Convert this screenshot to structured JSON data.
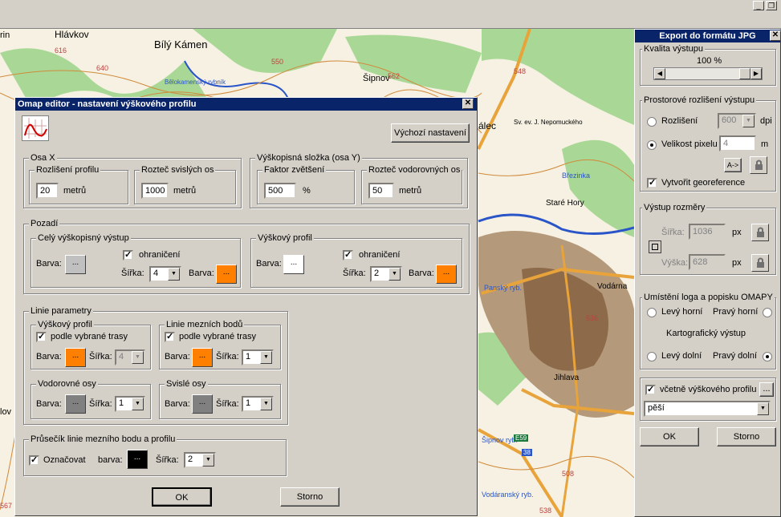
{
  "map": {
    "labels": [
      "rin",
      "Hlávkov",
      "Bílý Kámen",
      "550",
      "Bělokamenský rybník",
      "Šipnov",
      "562",
      "548",
      "616",
      "640",
      "Staré Hory",
      "Vodárna",
      "Panský ryb.",
      "Sv. ev. J. Nepomuckého",
      "Březinka",
      "E59",
      "38",
      "Šipnov ryb.",
      "Vodáranský ryb.",
      "567",
      "536",
      "508",
      "álec",
      "lov",
      "Jihlava",
      "538"
    ],
    "colors": {
      "road": "#e8a33a",
      "water": "#3060d0",
      "forest": "#9fd08a",
      "town": "#7a5a3a",
      "contour": "#c87830"
    }
  },
  "omap": {
    "title": "Omap editor - nastavení výškového profilu",
    "default_btn": "Výchozí nastavení",
    "osa_x": {
      "label": "Osa X",
      "res_label": "Rozlišení profilu",
      "res_val": "20",
      "res_unit": "metrů",
      "vert_label": "Rozteč svislých os",
      "vert_val": "1000",
      "vert_unit": "metrů"
    },
    "osa_y": {
      "label": "Výškopisná složka (osa Y)",
      "factor_label": "Faktor zvětšení",
      "factor_val": "500",
      "factor_unit": "%",
      "horiz_label": "Rozteč vodorovných os",
      "horiz_val": "50",
      "horiz_unit": "metrů"
    },
    "pozadi": {
      "label": "Pozadí",
      "cely": {
        "label": "Celý výškopisný výstup",
        "barva": "Barva:",
        "border": "ohraničení",
        "sirka_label": "Šířka:",
        "sirka": "4",
        "barva2": "Barva:"
      },
      "profil": {
        "label": "Výškový profil",
        "barva": "Barva:",
        "border": "ohraničení",
        "sirka_label": "Šířka:",
        "sirka": "2",
        "barva2": "Barva:"
      }
    },
    "linie": {
      "label": "Linie parametry",
      "vp": {
        "label": "Výškový profil",
        "check": "podle vybrané trasy",
        "barva": "Barva:",
        "sirka_label": "Šířka:",
        "sirka": "4"
      },
      "mb": {
        "label": "Linie mezních bodů",
        "check": "podle vybrané trasy",
        "barva": "Barva:",
        "sirka_label": "Šířka:",
        "sirka": "1"
      },
      "vo": {
        "label": "Vodorovné osy",
        "barva": "Barva:",
        "sirka_label": "Šířka:",
        "sirka": "1"
      },
      "so": {
        "label": "Svislé osy",
        "barva": "Barva:",
        "sirka_label": "Šířka:",
        "sirka": "1"
      }
    },
    "prusecik": {
      "label": "Průsečík linie mezního bodu a profilu",
      "check": "Označovat",
      "barva": "barva:",
      "sirka_label": "Šířka:",
      "sirka": "2"
    },
    "ok": "OK",
    "cancel": "Storno",
    "dots": "...",
    "colors": {
      "orange": "#ff8000",
      "gray": "#c0c0c0",
      "dark_gray": "#808080",
      "white": "#ffffff",
      "black": "#000000"
    }
  },
  "export": {
    "title": "Export do formátu JPG",
    "kvalita": {
      "label": "Kvalita výstupu",
      "value": "100 %",
      "fraction": 1.0
    },
    "prostor": {
      "label": "Prostorové rozlišení výstupu",
      "rozliseni": "Rozlišení",
      "dpi_val": "600",
      "dpi_unit": "dpi",
      "velikost": "Velikost pixelu",
      "px_val": "4",
      "m_unit": "m",
      "arrow_btn": "A->",
      "georef": "Vytvořit georeference"
    },
    "rozmery": {
      "label": "Výstup rozměry",
      "sirka_label": "Šířka:",
      "sirka_val": "1036",
      "vyska_label": "Výška:",
      "vyska_val": "628",
      "unit": "px"
    },
    "logo": {
      "label": "Umístění loga a popisku OMAPY",
      "lh": "Levý horní",
      "ph": "Pravý horní",
      "center": "Kartografický výstup",
      "ld": "Levý dolní",
      "pd": "Pravý dolní"
    },
    "profil_check": "včetně výškového profilu",
    "profil_btn": "...",
    "profil_select": "pěší",
    "ok": "OK",
    "cancel": "Storno"
  }
}
